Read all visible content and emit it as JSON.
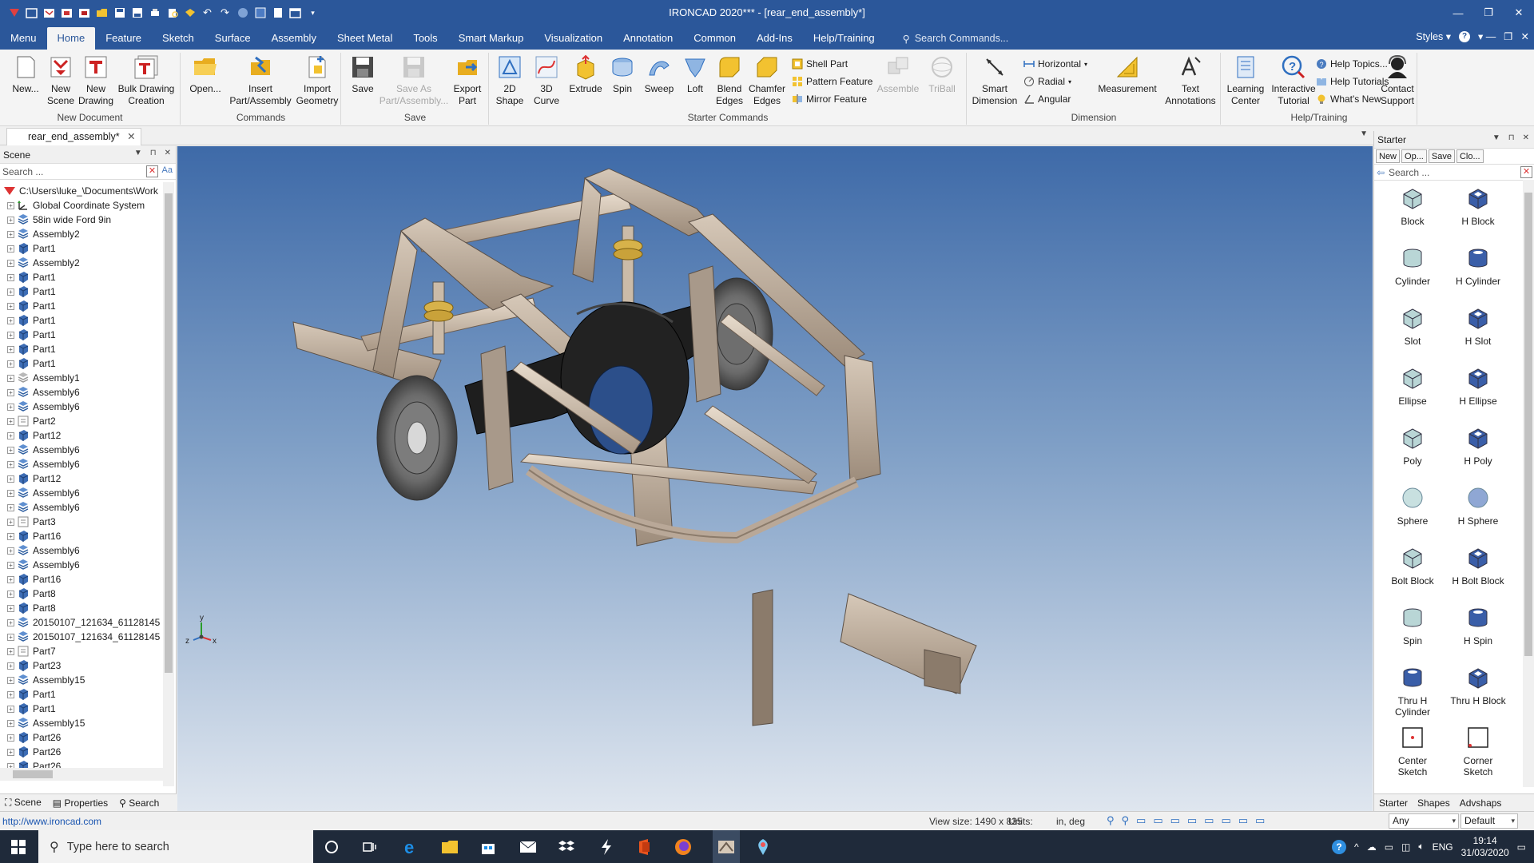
{
  "window": {
    "title": "IRONCAD 2020*** - [rear_end_assembly*]",
    "controls": [
      "minimize",
      "restore",
      "close"
    ]
  },
  "ribbon_tabs": [
    "Menu",
    "Home",
    "Feature",
    "Sketch",
    "Surface",
    "Assembly",
    "Sheet Metal",
    "Tools",
    "Smart Markup",
    "Visualization",
    "Annotation",
    "Common",
    "Add-Ins",
    "Help/Training"
  ],
  "active_tab": "Home",
  "command_search": {
    "placeholder": "Search Commands..."
  },
  "styles_label": "Styles",
  "ribbon": {
    "new_document": {
      "label": "New Document",
      "buttons": [
        {
          "label": "New...",
          "icon": "new-document-icon"
        },
        {
          "label": "New\nScene",
          "icon": "new-scene-icon"
        },
        {
          "label": "New\nDrawing",
          "icon": "new-drawing-icon"
        },
        {
          "label": "Bulk Drawing\nCreation",
          "icon": "bulk-drawing-icon"
        }
      ]
    },
    "commands": {
      "label": "Commands",
      "buttons": [
        {
          "label": "Open...",
          "icon": "open-folder-icon"
        },
        {
          "label": "Insert\nPart/Assembly",
          "icon": "insert-part-icon"
        },
        {
          "label": "Import\nGeometry",
          "icon": "import-geometry-icon"
        }
      ]
    },
    "save": {
      "label": "Save",
      "buttons": [
        {
          "label": "Save",
          "icon": "save-icon"
        },
        {
          "label": "Save As\nPart/Assembly...",
          "icon": "save-as-icon",
          "disabled": true
        },
        {
          "label": "Export\nPart",
          "icon": "export-part-icon"
        }
      ]
    },
    "starter_commands": {
      "label": "Starter Commands",
      "buttons": [
        {
          "label": "2D\nShape",
          "icon": "2d-shape-icon"
        },
        {
          "label": "3D\nCurve",
          "icon": "3d-curve-icon"
        },
        {
          "label": "Extrude",
          "icon": "extrude-icon"
        },
        {
          "label": "Spin",
          "icon": "spin-icon"
        },
        {
          "label": "Sweep",
          "icon": "sweep-icon"
        },
        {
          "label": "Loft",
          "icon": "loft-icon"
        },
        {
          "label": "Blend\nEdges",
          "icon": "blend-edges-icon"
        },
        {
          "label": "Chamfer\nEdges",
          "icon": "chamfer-edges-icon"
        }
      ],
      "small_buttons": [
        "Shell Part",
        "Pattern Feature",
        "Mirror Feature"
      ],
      "disabled_buttons": [
        "Assemble",
        "TriBall"
      ]
    },
    "dimension": {
      "label": "Dimension",
      "buttons": [
        {
          "label": "Smart\nDimension",
          "icon": "smart-dimension-icon"
        },
        {
          "label": "Measurement",
          "icon": "measurement-icon"
        },
        {
          "label": "Text\nAnnotations",
          "icon": "text-annotations-icon"
        }
      ],
      "small_buttons": [
        "Horizontal",
        "Radial",
        "Angular"
      ]
    },
    "help_training": {
      "label": "Help/Training",
      "buttons": [
        {
          "label": "Learning\nCenter",
          "icon": "learning-center-icon"
        },
        {
          "label": "Interactive\nTutorial",
          "icon": "interactive-tutorial-icon"
        },
        {
          "label": "Contact\nSupport",
          "icon": "contact-support-icon"
        }
      ],
      "small_buttons": [
        "Help Topics...",
        "Help Tutorials",
        "What's New"
      ]
    }
  },
  "document_tab": "rear_end_assembly*",
  "scene_panel": {
    "title": "Scene",
    "search_placeholder": "Search ...",
    "root": "C:\\Users\\luke_\\Documents\\Work",
    "items": [
      {
        "label": "Global Coordinate System",
        "type": "coord"
      },
      {
        "label": "58in wide Ford 9in",
        "type": "assembly"
      },
      {
        "label": "Assembly2",
        "type": "assembly"
      },
      {
        "label": "Part1",
        "type": "part"
      },
      {
        "label": "Assembly2",
        "type": "assembly"
      },
      {
        "label": "Part1",
        "type": "part"
      },
      {
        "label": "Part1",
        "type": "part"
      },
      {
        "label": "Part1",
        "type": "part"
      },
      {
        "label": "Part1",
        "type": "part"
      },
      {
        "label": "Part1",
        "type": "part"
      },
      {
        "label": "Part1",
        "type": "part"
      },
      {
        "label": "Part1",
        "type": "part"
      },
      {
        "label": "Assembly1",
        "type": "assembly-gray"
      },
      {
        "label": "Assembly6",
        "type": "assembly"
      },
      {
        "label": "Assembly6",
        "type": "assembly"
      },
      {
        "label": "Part2",
        "type": "part-gray"
      },
      {
        "label": "Part12",
        "type": "part"
      },
      {
        "label": "Assembly6",
        "type": "assembly"
      },
      {
        "label": "Assembly6",
        "type": "assembly"
      },
      {
        "label": "Part12",
        "type": "part"
      },
      {
        "label": "Assembly6",
        "type": "assembly"
      },
      {
        "label": "Assembly6",
        "type": "assembly"
      },
      {
        "label": "Part3",
        "type": "part-gray"
      },
      {
        "label": "Part16",
        "type": "part"
      },
      {
        "label": "Assembly6",
        "type": "assembly"
      },
      {
        "label": "Assembly6",
        "type": "assembly"
      },
      {
        "label": "Part16",
        "type": "part"
      },
      {
        "label": "Part8",
        "type": "part"
      },
      {
        "label": "Part8",
        "type": "part"
      },
      {
        "label": "20150107_121634_61128145",
        "type": "assembly"
      },
      {
        "label": "20150107_121634_61128145",
        "type": "assembly"
      },
      {
        "label": "Part7",
        "type": "part-gray"
      },
      {
        "label": "Part23",
        "type": "part"
      },
      {
        "label": "Assembly15",
        "type": "assembly"
      },
      {
        "label": "Part1",
        "type": "part"
      },
      {
        "label": "Part1",
        "type": "part"
      },
      {
        "label": "Assembly15",
        "type": "assembly"
      },
      {
        "label": "Part26",
        "type": "part"
      },
      {
        "label": "Part26",
        "type": "part"
      },
      {
        "label": "Part26",
        "type": "part"
      }
    ],
    "bottom_tabs": [
      "Scene",
      "Properties",
      "Search"
    ]
  },
  "starter_panel": {
    "title": "Starter",
    "buttons": [
      "New",
      "Op...",
      "Save",
      "Clo..."
    ],
    "search_placeholder": "Search ...",
    "items": [
      {
        "label": "Block",
        "icon": "block-icon"
      },
      {
        "label": "H Block",
        "icon": "h-block-icon"
      },
      {
        "label": "Cylinder",
        "icon": "cylinder-icon"
      },
      {
        "label": "H Cylinder",
        "icon": "h-cylinder-icon"
      },
      {
        "label": "Slot",
        "icon": "slot-icon"
      },
      {
        "label": "H Slot",
        "icon": "h-slot-icon"
      },
      {
        "label": "Ellipse",
        "icon": "ellipse-icon"
      },
      {
        "label": "H Ellipse",
        "icon": "h-ellipse-icon"
      },
      {
        "label": "Poly",
        "icon": "poly-icon"
      },
      {
        "label": "H Poly",
        "icon": "h-poly-icon"
      },
      {
        "label": "Sphere",
        "icon": "sphere-icon"
      },
      {
        "label": "H Sphere",
        "icon": "h-sphere-icon"
      },
      {
        "label": "Bolt Block",
        "icon": "bolt-block-icon"
      },
      {
        "label": "H Bolt Block",
        "icon": "h-bolt-block-icon"
      },
      {
        "label": "Spin",
        "icon": "spin-shape-icon"
      },
      {
        "label": "H Spin",
        "icon": "h-spin-icon"
      },
      {
        "label": "Thru H\nCylinder",
        "icon": "thru-h-cylinder-icon"
      },
      {
        "label": "Thru H Block",
        "icon": "thru-h-block-icon"
      },
      {
        "label": "Center\nSketch",
        "icon": "center-sketch-icon"
      },
      {
        "label": "Corner\nSketch",
        "icon": "corner-sketch-icon"
      }
    ],
    "bottom_tabs": [
      "Starter",
      "Shapes",
      "Advshaps"
    ]
  },
  "statusbar": {
    "link": "http://www.ironcad.com",
    "view_size": "View size: 1490 x  835",
    "units_label": "Units:",
    "units_value": "in, deg",
    "filter_value": "Any",
    "style_value": "Default"
  },
  "axis_triad": {
    "x": "x",
    "y": "y",
    "z": "z"
  },
  "taskbar": {
    "search_placeholder": "Type here to search",
    "language": "ENG",
    "time": "19:14",
    "date": "31/03/2020"
  },
  "colors": {
    "title_bar": "#2b579a",
    "viewport_top": "#3e6aa8",
    "viewport_bottom": "#dfe6ef",
    "frame_tube": "#b9a898",
    "axle_housing": "#1c1c1c",
    "brake_rotor": "#6e6e6e"
  }
}
